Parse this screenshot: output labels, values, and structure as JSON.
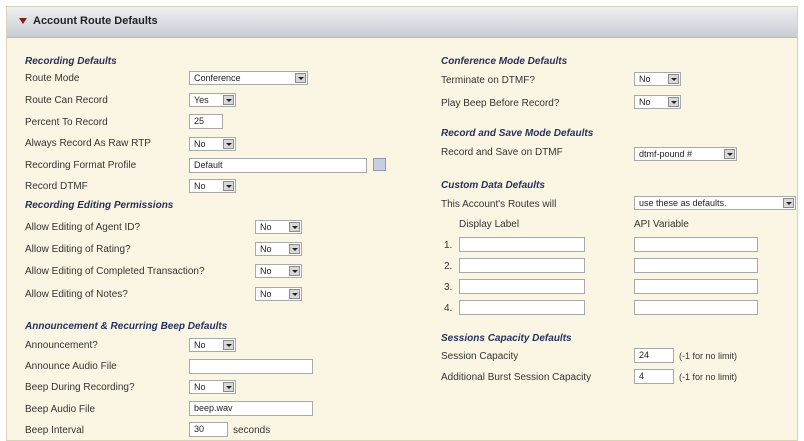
{
  "header": {
    "title": "Account Route Defaults"
  },
  "recording": {
    "section": "Recording Defaults",
    "route_mode_label": "Route Mode",
    "route_mode_value": "Conference",
    "can_record_label": "Route Can Record",
    "can_record_value": "Yes",
    "percent_label": "Percent To Record",
    "percent_value": "25",
    "raw_rtp_label": "Always Record As Raw RTP",
    "raw_rtp_value": "No",
    "format_label": "Recording Format Profile",
    "format_value": "Default",
    "dtmf_label": "Record DTMF",
    "dtmf_value": "No"
  },
  "permissions": {
    "section": "Recording Editing Permissions",
    "agent_label": "Allow Editing of Agent ID?",
    "agent_value": "No",
    "rating_label": "Allow Editing of Rating?",
    "rating_value": "No",
    "completed_label": "Allow Editing of Completed Transaction?",
    "completed_value": "No",
    "notes_label": "Allow Editing of Notes?",
    "notes_value": "No"
  },
  "announcement": {
    "section": "Announcement & Recurring Beep Defaults",
    "ann_label": "Announcement?",
    "ann_value": "No",
    "audio_label": "Announce Audio File",
    "audio_value": "",
    "beep_label": "Beep During Recording?",
    "beep_value": "No",
    "beep_file_label": "Beep Audio File",
    "beep_file_value": "beep.wav",
    "interval_label": "Beep Interval",
    "interval_value": "30",
    "interval_unit": "seconds"
  },
  "conference": {
    "section": "Conference Mode Defaults",
    "terminate_label": "Terminate on DTMF?",
    "terminate_value": "No",
    "play_beep_label": "Play Beep Before Record?",
    "play_beep_value": "No"
  },
  "record_save": {
    "section": "Record and Save Mode Defaults",
    "dtmf_label": "Record and Save on DTMF",
    "dtmf_value": "dtmf-pound #"
  },
  "custom": {
    "section": "Custom Data Defaults",
    "routes_label": "This Account's Routes will",
    "routes_value": "use these as defaults.",
    "col_display": "Display Label",
    "col_api": "API Variable",
    "rows": [
      {
        "num": "1.",
        "display": "",
        "api": ""
      },
      {
        "num": "2.",
        "display": "",
        "api": ""
      },
      {
        "num": "3.",
        "display": "",
        "api": ""
      },
      {
        "num": "4.",
        "display": "",
        "api": ""
      }
    ]
  },
  "sessions": {
    "section": "Sessions Capacity Defaults",
    "capacity_label": "Session Capacity",
    "capacity_value": "24",
    "capacity_note": "(-1 for no limit)",
    "burst_label": "Additional Burst Session Capacity",
    "burst_value": "4",
    "burst_note": "(-1 for no limit)"
  }
}
